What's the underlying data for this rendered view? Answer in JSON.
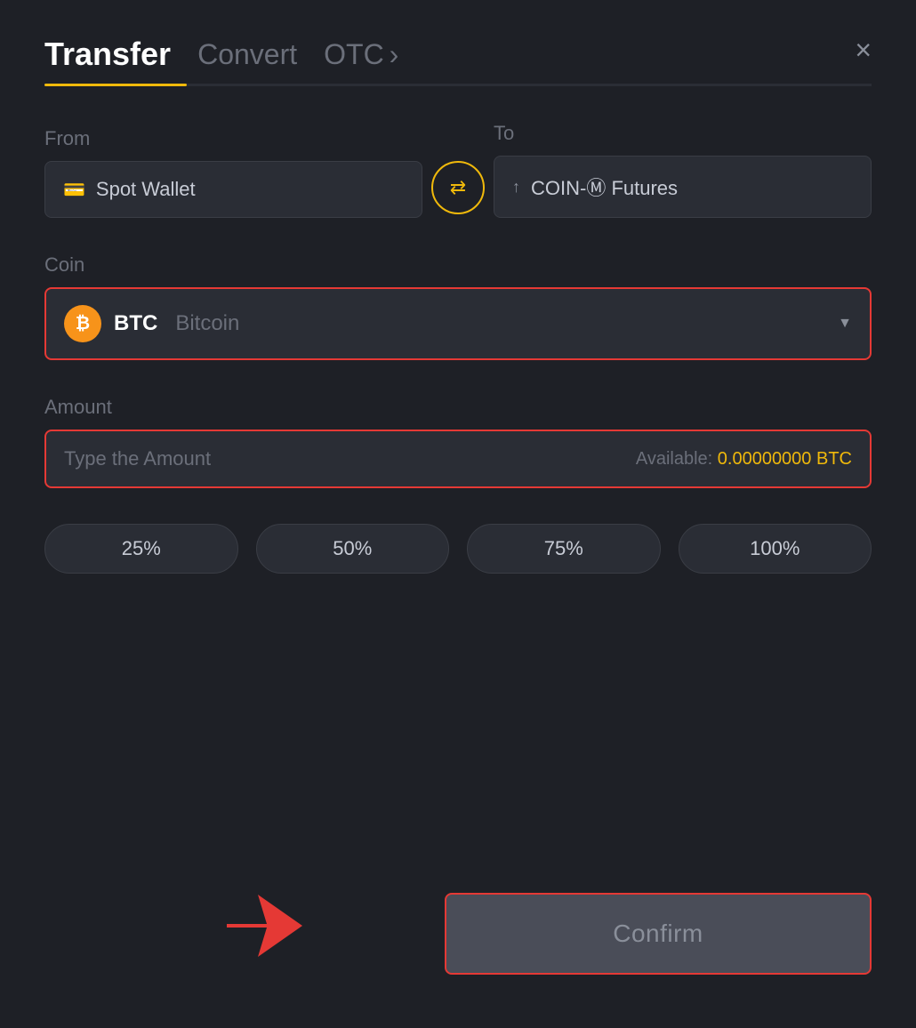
{
  "header": {
    "tab_transfer": "Transfer",
    "tab_convert": "Convert",
    "tab_otc": "OTC",
    "tab_otc_arrow": "›",
    "close_label": "×"
  },
  "from_section": {
    "label": "From",
    "wallet_icon": "💳",
    "wallet_name": "Spot Wallet"
  },
  "swap": {
    "icon": "⇄"
  },
  "to_section": {
    "label": "To",
    "wallet_icon": "↑",
    "wallet_name": "COIN-Ⓜ Futures"
  },
  "coin_section": {
    "label": "Coin",
    "coin_symbol": "BTC",
    "coin_name": "Bitcoin",
    "coin_icon_letter": "₿"
  },
  "amount_section": {
    "label": "Amount",
    "placeholder": "Type the Amount",
    "available_label": "Available:",
    "available_value": "0.00000000 BTC"
  },
  "percent_buttons": [
    {
      "label": "25%",
      "value": "25"
    },
    {
      "label": "50%",
      "value": "50"
    },
    {
      "label": "75%",
      "value": "75"
    },
    {
      "label": "100%",
      "value": "100"
    }
  ],
  "confirm_button": {
    "label": "Confirm"
  }
}
